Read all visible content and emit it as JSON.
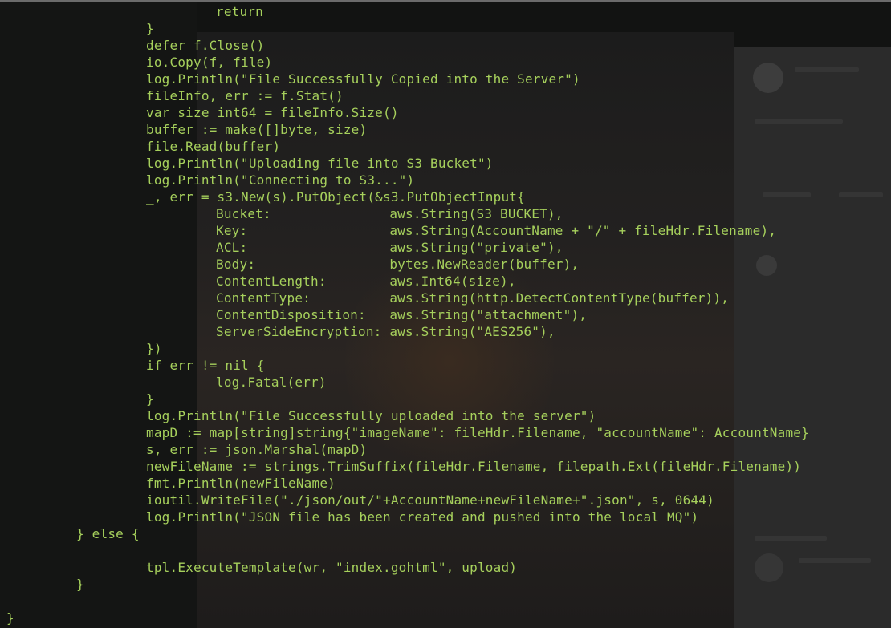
{
  "terminal": {
    "text_color": "#a6d05c",
    "background": "#121312",
    "lines": [
      {
        "indent": 3,
        "text": "return"
      },
      {
        "indent": 2,
        "text": "}"
      },
      {
        "indent": 2,
        "text": "defer f.Close()"
      },
      {
        "indent": 2,
        "text": "io.Copy(f, file)"
      },
      {
        "indent": 2,
        "text": "log.Println(\"File Successfully Copied into the Server\")"
      },
      {
        "indent": 2,
        "text": "fileInfo, err := f.Stat()"
      },
      {
        "indent": 2,
        "text": "var size int64 = fileInfo.Size()"
      },
      {
        "indent": 2,
        "text": "buffer := make([]byte, size)"
      },
      {
        "indent": 2,
        "text": "file.Read(buffer)"
      },
      {
        "indent": 2,
        "text": "log.Println(\"Uploading file into S3 Bucket\")"
      },
      {
        "indent": 2,
        "text": "log.Println(\"Connecting to S3...\")"
      },
      {
        "indent": 2,
        "text": "_, err = s3.New(s).PutObject(&s3.PutObjectInput{"
      },
      {
        "indent": 3,
        "text": "Bucket:               aws.String(S3_BUCKET),"
      },
      {
        "indent": 3,
        "text": "Key:                  aws.String(AccountName + \"/\" + fileHdr.Filename),"
      },
      {
        "indent": 3,
        "text": "ACL:                  aws.String(\"private\"),"
      },
      {
        "indent": 3,
        "text": "Body:                 bytes.NewReader(buffer),"
      },
      {
        "indent": 3,
        "text": "ContentLength:        aws.Int64(size),"
      },
      {
        "indent": 3,
        "text": "ContentType:          aws.String(http.DetectContentType(buffer)),"
      },
      {
        "indent": 3,
        "text": "ContentDisposition:   aws.String(\"attachment\"),"
      },
      {
        "indent": 3,
        "text": "ServerSideEncryption: aws.String(\"AES256\"),"
      },
      {
        "indent": 2,
        "text": "})"
      },
      {
        "indent": 2,
        "text": "if err != nil {"
      },
      {
        "indent": 3,
        "text": "log.Fatal(err)"
      },
      {
        "indent": 2,
        "text": "}"
      },
      {
        "indent": 2,
        "text": "log.Println(\"File Successfully uploaded into the server\")"
      },
      {
        "indent": 2,
        "text": "mapD := map[string]string{\"imageName\": fileHdr.Filename, \"accountName\": AccountName}"
      },
      {
        "indent": 2,
        "text": "s, err := json.Marshal(mapD)"
      },
      {
        "indent": 2,
        "text": "newFileName := strings.TrimSuffix(fileHdr.Filename, filepath.Ext(fileHdr.Filename))"
      },
      {
        "indent": 2,
        "text": "fmt.Println(newFileName)"
      },
      {
        "indent": 2,
        "text": "ioutil.WriteFile(\"./json/out/\"+AccountName+newFileName+\".json\", s, 0644)"
      },
      {
        "indent": 2,
        "text": "log.Println(\"JSON file has been created and pushed into the local MQ\")"
      },
      {
        "indent": 1,
        "text": "} else {"
      },
      {
        "indent": 0,
        "text": ""
      },
      {
        "indent": 2,
        "text": "tpl.ExecuteTemplate(wr, \"index.gohtml\", upload)"
      },
      {
        "indent": 1,
        "text": "}"
      },
      {
        "indent": 0,
        "text": ""
      },
      {
        "indent": 0,
        "text": "}"
      }
    ]
  }
}
